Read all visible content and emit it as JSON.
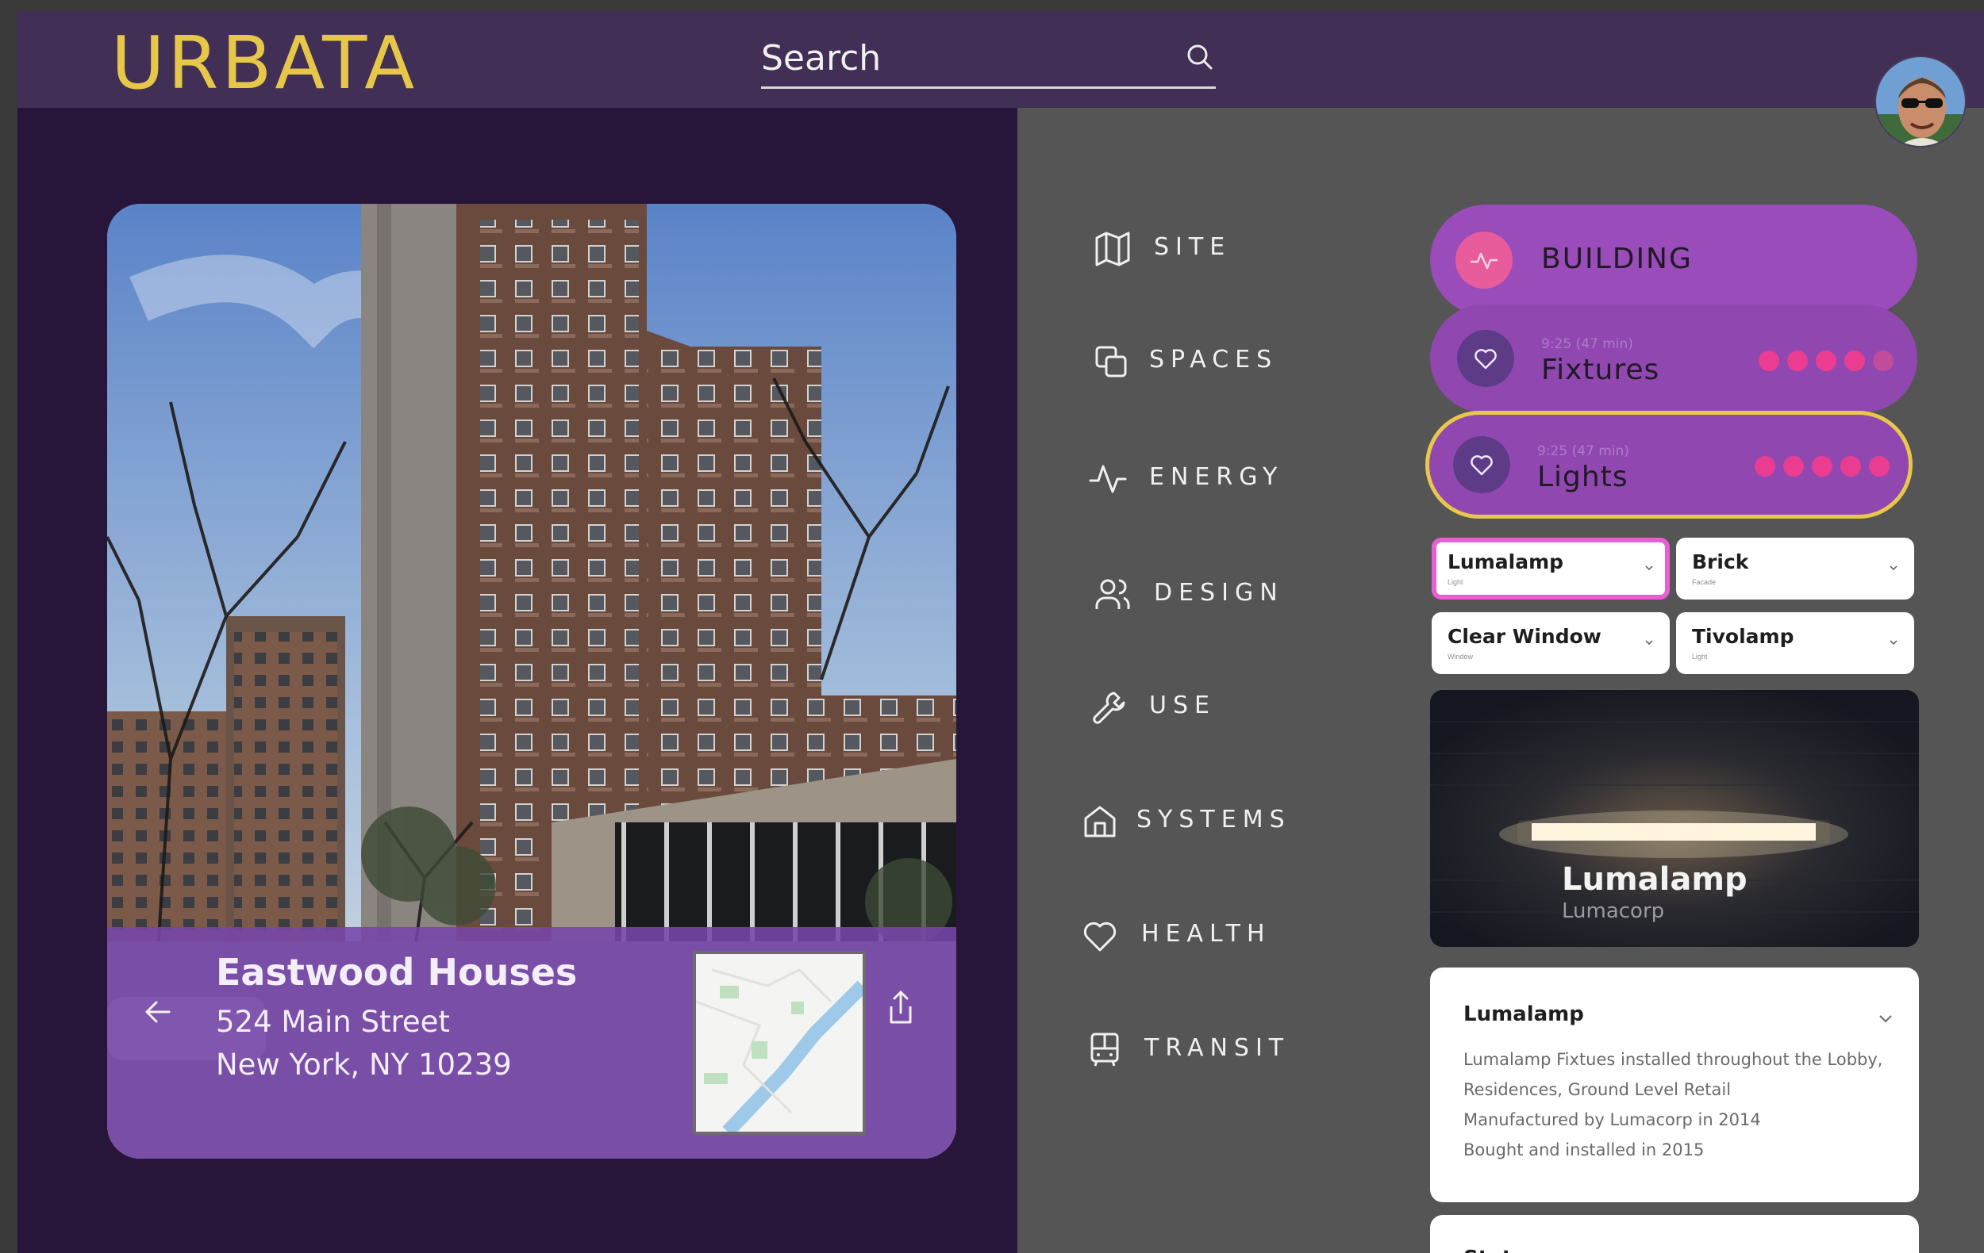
{
  "app": {
    "brand": "URBATA"
  },
  "search": {
    "placeholder": "Search"
  },
  "building_card": {
    "name": "Eastwood Houses",
    "address_line1": "524 Main Street",
    "address_line2": "New York, NY 10239"
  },
  "nav": {
    "items": [
      {
        "label": "SITE",
        "icon": "map-icon"
      },
      {
        "label": "SPACES",
        "icon": "copy-icon"
      },
      {
        "label": "ENERGY",
        "icon": "activity-icon"
      },
      {
        "label": "DESIGN",
        "icon": "users-icon"
      },
      {
        "label": "USE",
        "icon": "wrench-icon"
      },
      {
        "label": "SYSTEMS",
        "icon": "home-icon"
      },
      {
        "label": "HEALTH",
        "icon": "heart-icon"
      },
      {
        "label": "TRANSIT",
        "icon": "bus-icon"
      }
    ]
  },
  "panels": {
    "building": {
      "title": "BUILDING",
      "icon": "activity-icon"
    },
    "fixtures": {
      "title": "Fixtures",
      "subtitle": "9:25 (47 min)",
      "icon": "heart-icon",
      "rating_filled": 4,
      "rating_total": 5
    },
    "lights": {
      "title": "Lights",
      "subtitle": "9:25 (47 min)",
      "icon": "heart-icon",
      "rating_filled": 5,
      "rating_total": 5
    }
  },
  "selects": [
    {
      "label": "Lumalamp",
      "sublabel": "Light"
    },
    {
      "label": "Brick",
      "sublabel": "Facade"
    },
    {
      "label": "Clear Window",
      "sublabel": "Window"
    },
    {
      "label": "Tivolamp",
      "sublabel": "Light"
    }
  ],
  "product": {
    "name": "Lumalamp",
    "manufacturer": "Lumacorp"
  },
  "detail": {
    "title": "Lumalamp",
    "lines": [
      "Lumalamp Fixtues installed throughout the Lobby,",
      "Residences, Ground Level Retail",
      "Manufactured by Lumacorp in 2014",
      "Bought and installed in 2015"
    ]
  },
  "stats": {
    "title": "Stats"
  },
  "colors": {
    "topbar": "#412f55",
    "left_panel": "#28163a",
    "brand_yellow": "#e6c74a",
    "pill_purple": "#9048b0",
    "dot_pink": "#ea3d92",
    "selected_outline": "#e7c84b",
    "select_highlight": "#e85fd3"
  }
}
